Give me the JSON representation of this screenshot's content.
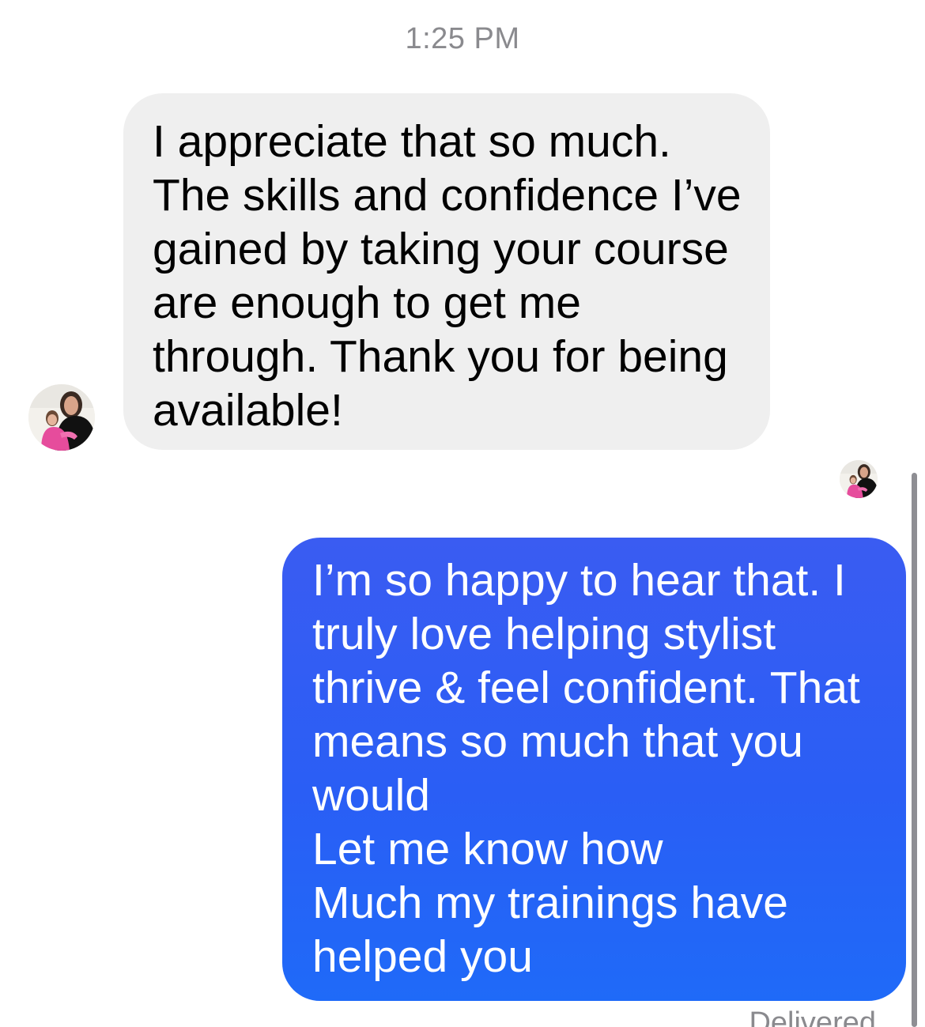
{
  "conversation": {
    "timestamp": "1:25 PM",
    "messages": [
      {
        "direction": "incoming",
        "text": "I appreciate that so much.\nThe skills and confidence I’ve gained by taking your course are enough to get me through. Thank you for being available!",
        "bubble_color": "#efefef",
        "text_color": "#000000"
      },
      {
        "direction": "outgoing",
        "text": "I’m so happy to hear that. I truly love helping stylist thrive & feel confident. That means so much that you would\nLet me know how\nMuch my trainings have helped you",
        "bubble_color": "#2a5ef5",
        "text_color": "#ffffff"
      }
    ],
    "status": "Delivered"
  },
  "icons": {
    "contact_avatar": "contact-avatar-photo",
    "read_receipt_avatar": "read-receipt-avatar-photo"
  },
  "colors": {
    "background": "#ffffff",
    "meta_text": "#8a8a8e",
    "scrollbar": "#8e8e93"
  }
}
